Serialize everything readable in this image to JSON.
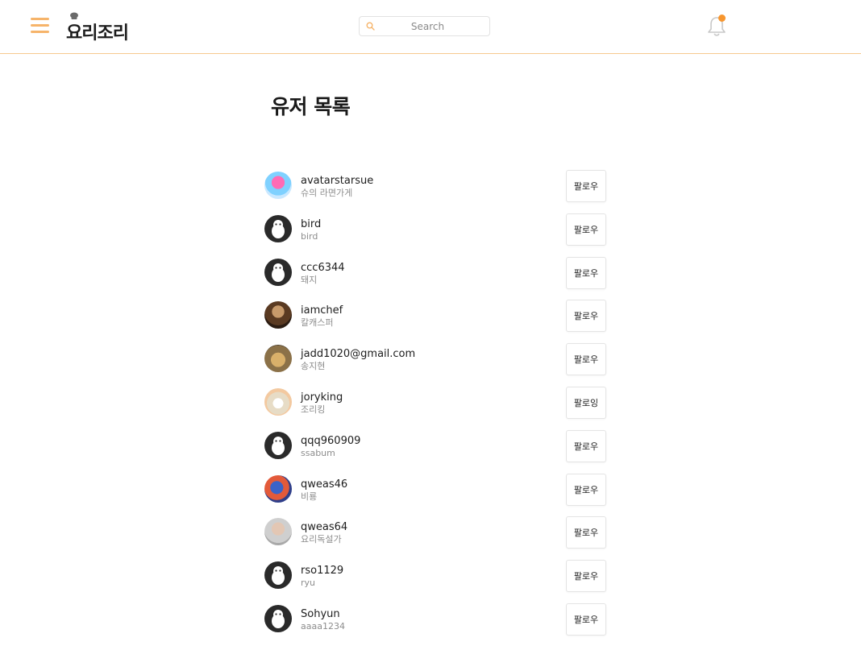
{
  "header": {
    "logo_text": "요리조리",
    "search_placeholder": "Search",
    "colors": {
      "accent": "#f6b46a",
      "notification_dot": "#f7962e",
      "header_border": "#f7c98f"
    }
  },
  "page_title": "유저 목록",
  "users": [
    {
      "username": "avatarstarsue",
      "nickname": "슈의 라면가게",
      "button": "팔로우",
      "avatar": "photo"
    },
    {
      "username": "bird",
      "nickname": "bird",
      "button": "팔로우",
      "avatar": "default"
    },
    {
      "username": "ccc6344",
      "nickname": "돼지",
      "button": "팔로우",
      "avatar": "default"
    },
    {
      "username": "iamchef",
      "nickname": "칼캐스퍼",
      "button": "팔로우",
      "avatar": "photo"
    },
    {
      "username": "jadd1020@gmail.com",
      "nickname": "송지현",
      "button": "팔로우",
      "avatar": "photo"
    },
    {
      "username": "joryking",
      "nickname": "조리킹",
      "button": "팔로잉",
      "avatar": "photo"
    },
    {
      "username": "qqq960909",
      "nickname": "ssabum",
      "button": "팔로우",
      "avatar": "default"
    },
    {
      "username": "qweas46",
      "nickname": "비룡",
      "button": "팔로우",
      "avatar": "photo"
    },
    {
      "username": "qweas64",
      "nickname": "요리독설가",
      "button": "팔로우",
      "avatar": "photo"
    },
    {
      "username": "rso1129",
      "nickname": "ryu",
      "button": "팔로우",
      "avatar": "default"
    },
    {
      "username": "Sohyun",
      "nickname": "aaaa1234",
      "button": "팔로우",
      "avatar": "default"
    }
  ]
}
